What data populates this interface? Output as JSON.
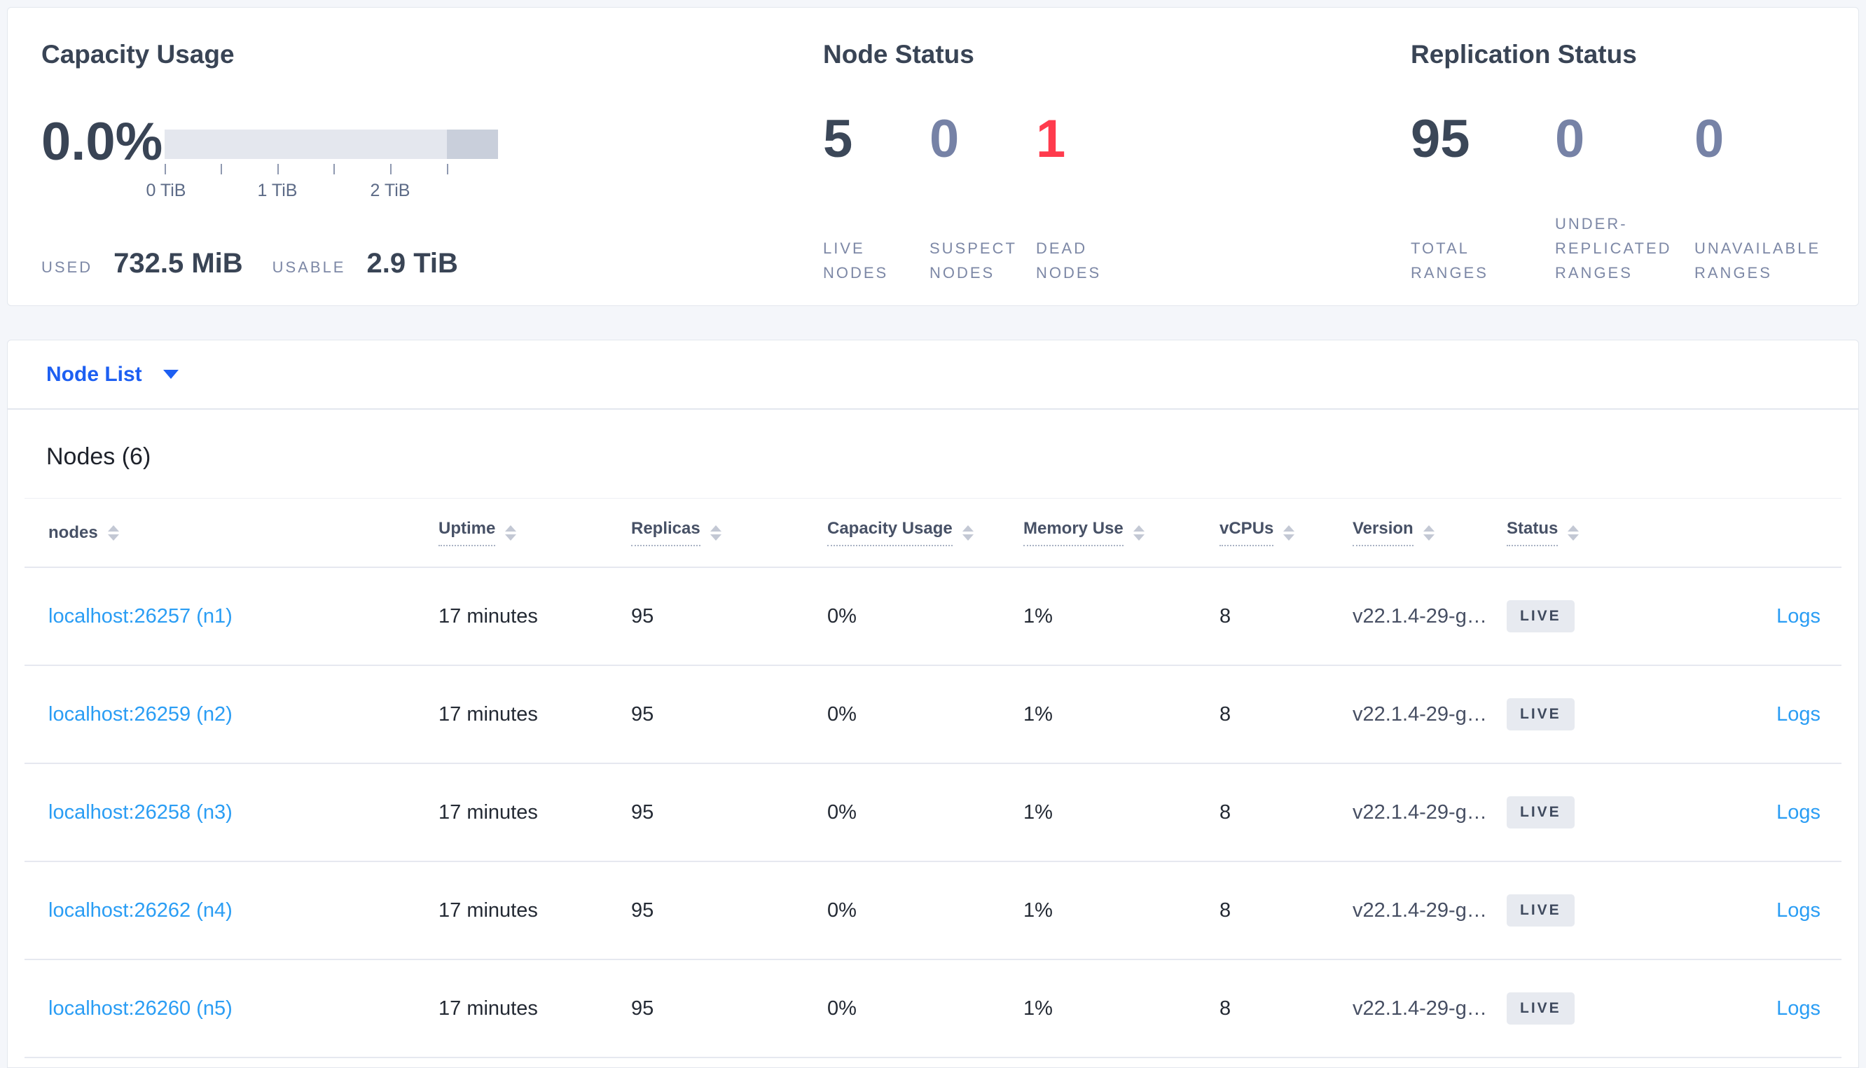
{
  "colors": {
    "accent_blue": "#1d5ff2",
    "link_blue": "#2a9df4",
    "danger_red": "#ff3b4d",
    "dark_slate": "#3b4758",
    "muted_number": "#7682a6",
    "label_gray": "#7d88a6",
    "badge_bg": "#e7eaf0",
    "capacity_bar_light": "#e4e7ee",
    "capacity_bar_dark": "#c9cfdb"
  },
  "summary": {
    "capacity": {
      "title": "Capacity Usage",
      "percent": "0.0%",
      "axis_tick_labels": [
        "0 TiB",
        "1 TiB",
        "2 TiB"
      ],
      "axis_tick_step": "0.5 TiB",
      "used_label": "USED",
      "used_value": "732.5 MiB",
      "usable_label": "USABLE",
      "usable_value": "2.9 TiB"
    },
    "node_status": {
      "title": "Node Status",
      "stats": [
        {
          "value": "5",
          "label": "LIVE\nNODES",
          "tone": "primary"
        },
        {
          "value": "0",
          "label": "SUSPECT\nNODES",
          "tone": "muted"
        },
        {
          "value": "1",
          "label": "DEAD\nNODES",
          "tone": "danger"
        }
      ]
    },
    "replication_status": {
      "title": "Replication Status",
      "stats": [
        {
          "value": "95",
          "label": "TOTAL\nRANGES",
          "tone": "primary"
        },
        {
          "value": "0",
          "label": "UNDER-\nREPLICATED\nRANGES",
          "tone": "muted"
        },
        {
          "value": "0",
          "label": "UNAVAILABLE\nRANGES",
          "tone": "muted"
        }
      ]
    }
  },
  "view_selector": {
    "label": "Node List"
  },
  "nodes_section": {
    "title": "Nodes (6)",
    "table": {
      "columns": {
        "nodes": "nodes",
        "uptime": "Uptime",
        "replicas": "Replicas",
        "capacity": "Capacity Usage",
        "memory": "Memory Use",
        "vcpus": "vCPUs",
        "version": "Version",
        "status": "Status"
      },
      "rows": [
        {
          "node": "localhost:26257 (n1)",
          "uptime": "17 minutes",
          "replicas": "95",
          "capacity": "0%",
          "memory": "1%",
          "vcpus": "8",
          "version": "v22.1.4-29-g…",
          "status": "LIVE",
          "logs": "Logs"
        },
        {
          "node": "localhost:26259 (n2)",
          "uptime": "17 minutes",
          "replicas": "95",
          "capacity": "0%",
          "memory": "1%",
          "vcpus": "8",
          "version": "v22.1.4-29-g…",
          "status": "LIVE",
          "logs": "Logs"
        },
        {
          "node": "localhost:26258 (n3)",
          "uptime": "17 minutes",
          "replicas": "95",
          "capacity": "0%",
          "memory": "1%",
          "vcpus": "8",
          "version": "v22.1.4-29-g…",
          "status": "LIVE",
          "logs": "Logs"
        },
        {
          "node": "localhost:26262 (n4)",
          "uptime": "17 minutes",
          "replicas": "95",
          "capacity": "0%",
          "memory": "1%",
          "vcpus": "8",
          "version": "v22.1.4-29-g…",
          "status": "LIVE",
          "logs": "Logs"
        },
        {
          "node": "localhost:26260 (n5)",
          "uptime": "17 minutes",
          "replicas": "95",
          "capacity": "0%",
          "memory": "1%",
          "vcpus": "8",
          "version": "v22.1.4-29-g…",
          "status": "LIVE",
          "logs": "Logs"
        }
      ]
    }
  }
}
